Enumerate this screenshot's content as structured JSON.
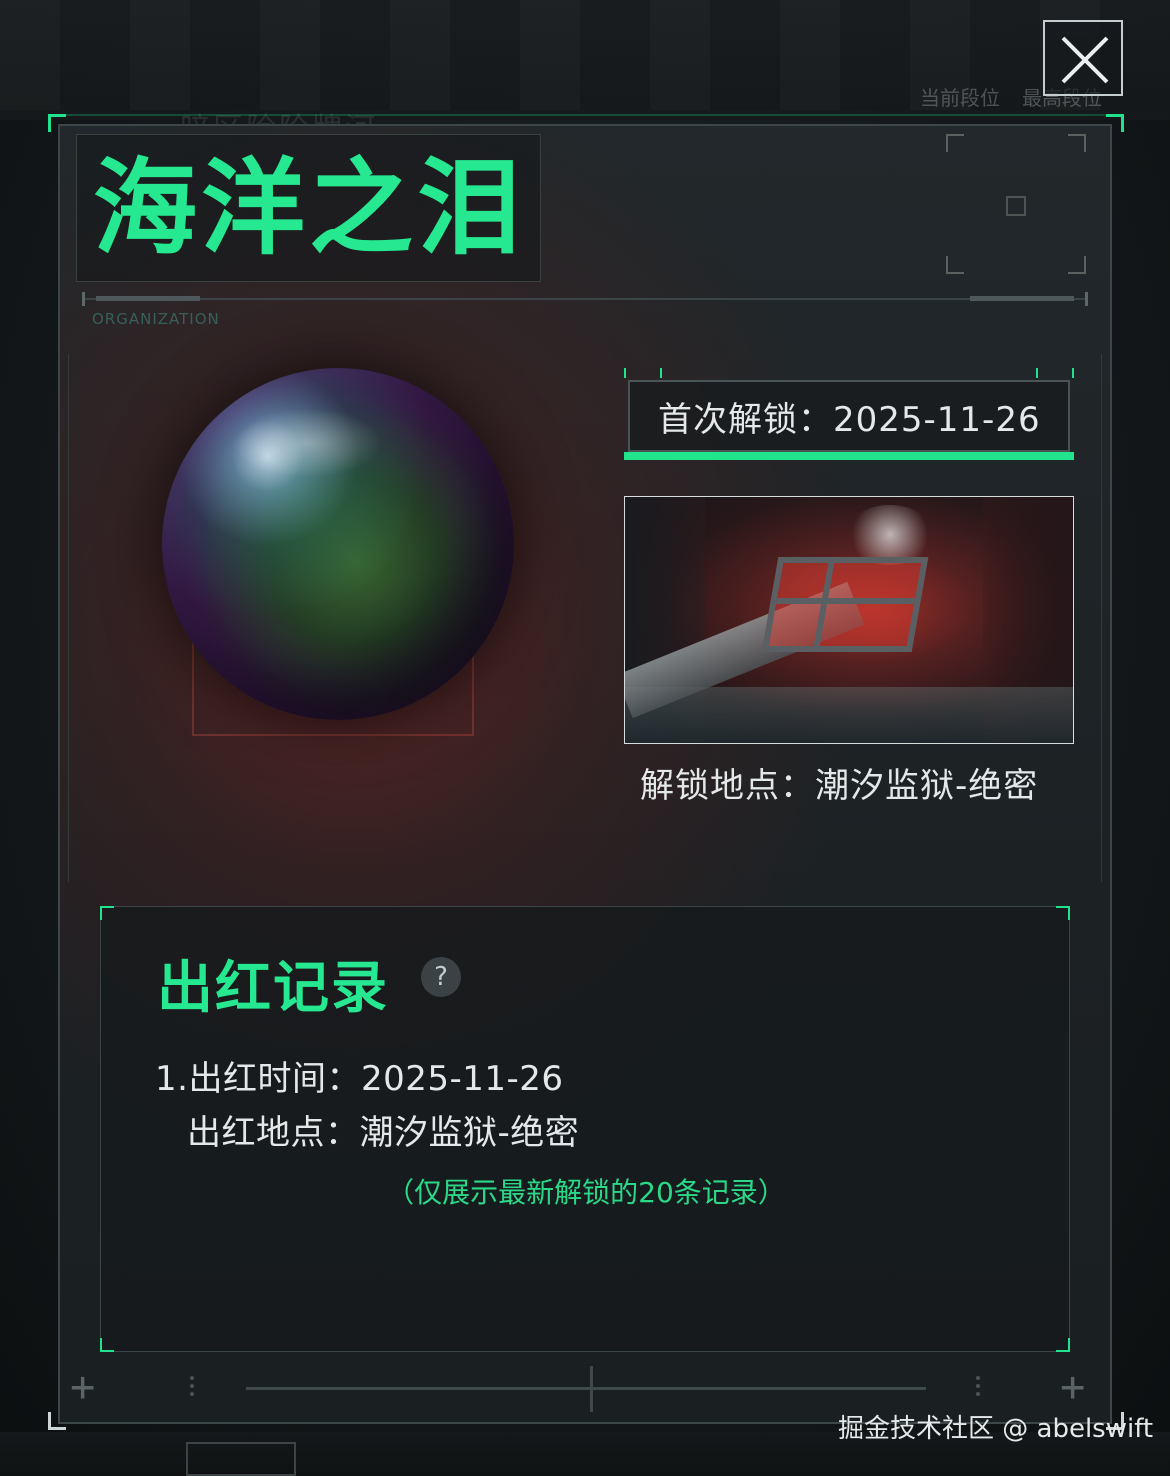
{
  "background": {
    "faded_title": "暗区险阶牌河",
    "rank_labels": [
      "当前段位",
      "最高段位"
    ]
  },
  "close_button": {
    "icon": "close-icon"
  },
  "item": {
    "name": "海洋之泪",
    "org_label": "ORGANIZATION",
    "first_unlock_label": "首次解锁：",
    "first_unlock_date": "2025-11-26",
    "unlock_location_label": "解锁地点：",
    "unlock_location": "潮汐监狱-绝密"
  },
  "records": {
    "title": "出红记录",
    "help_icon_glyph": "?",
    "entries": [
      {
        "index": "1.",
        "time_label": "出红时间：",
        "time": "2025-11-26",
        "place_label": "出红地点：",
        "place": "潮汐监狱-绝密"
      }
    ],
    "note": "（仅展示最新解锁的20条记录）"
  },
  "watermark": "掘金技术社区 @ abelswift",
  "colors": {
    "accent": "#26e891",
    "panel_bg": "#1f2427",
    "text": "#e4e8e9",
    "red_glow": "#96281f"
  }
}
